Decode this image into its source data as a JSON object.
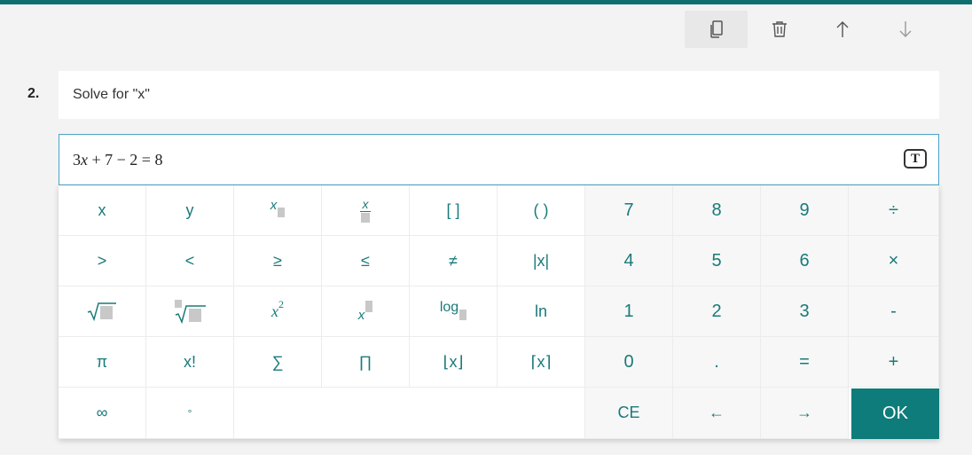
{
  "question": {
    "number": "2.",
    "title": "Solve for \"x\""
  },
  "answer": {
    "expression_parts": [
      "3",
      "x",
      " + 7 − 2 = 8"
    ],
    "text_mode_label": "T"
  },
  "toolbar": {
    "copy": "copy-icon",
    "delete": "trash-icon",
    "move_up": "arrow-up-icon",
    "move_down": "arrow-down-icon"
  },
  "keypad": {
    "rows": [
      [
        "x",
        "y",
        "x_sub",
        "x_frac",
        "[ ]",
        "( )",
        "7",
        "8",
        "9",
        "÷"
      ],
      [
        ">",
        "<",
        "≥",
        "≤",
        "≠",
        "|x|",
        "4",
        "5",
        "6",
        "×"
      ],
      [
        "sqrt",
        "nroot",
        "x²",
        "x_sup",
        "log_",
        "ln",
        "1",
        "2",
        "3",
        "-"
      ],
      [
        "π",
        "x!",
        "∑",
        "∏",
        "⌊x⌋",
        "⌈x⌉",
        "0",
        ".",
        "=",
        "+"
      ],
      [
        "∞",
        "°",
        "",
        "",
        "",
        "",
        "CE",
        "←",
        "→",
        "OK"
      ]
    ],
    "labels": {
      "k_x": "x",
      "k_y": "y",
      "k_brackets": "[ ]",
      "k_parens": "( )",
      "k_7": "7",
      "k_8": "8",
      "k_9": "9",
      "k_div": "÷",
      "k_gt": ">",
      "k_lt": "<",
      "k_ge": "≥",
      "k_le": "≤",
      "k_ne": "≠",
      "k_abs": "|x|",
      "k_4": "4",
      "k_5": "5",
      "k_6": "6",
      "k_mul": "×",
      "k_ln": "ln",
      "k_1": "1",
      "k_2": "2",
      "k_3": "3",
      "k_minus": "-",
      "k_pi": "π",
      "k_fact": "x!",
      "k_sum": "∑",
      "k_prod": "∏",
      "k_floor": "⌊x⌋",
      "k_ceil": "⌈x⌉",
      "k_0": "0",
      "k_dot": ".",
      "k_eq": "=",
      "k_plus": "+",
      "k_inf": "∞",
      "k_deg": "°",
      "k_ce": "CE",
      "k_left": "←",
      "k_right": "→",
      "k_ok": "OK",
      "k_sq_base": "x",
      "k_sq_exp": "2",
      "k_sup_base": "x",
      "k_sub_base": "x",
      "k_frac_num": "x",
      "k_log": "log"
    }
  },
  "colors": {
    "accent": "#0e6e6e",
    "key_text": "#1a7a7a",
    "ok_bg": "#0e7c7b",
    "focus_border": "#4aa3c9"
  }
}
